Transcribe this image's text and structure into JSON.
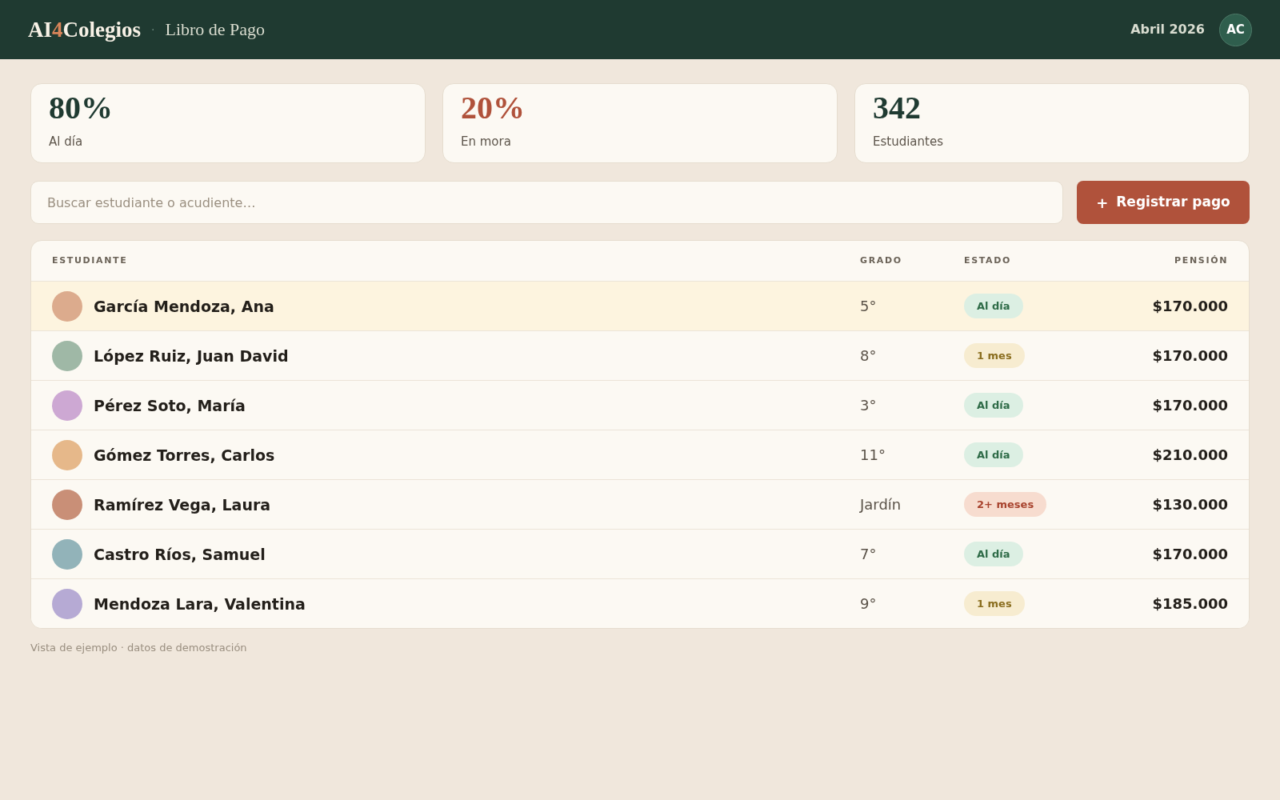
{
  "header": {
    "logo": {
      "before": "AI",
      "accent": "4",
      "after": "Colegios"
    },
    "separator": "·",
    "section": "Libro de Pago",
    "period": "Abril 2026",
    "avatar": "AC"
  },
  "stats": [
    {
      "value": "80%",
      "label": "Al día",
      "kind": "ok"
    },
    {
      "value": "20%",
      "label": "En mora",
      "kind": "alert"
    },
    {
      "value": "342",
      "label": "Estudiantes",
      "kind": "count"
    }
  ],
  "search": {
    "placeholder": "Buscar estudiante o acudiente…"
  },
  "register_button": {
    "icon": "+",
    "label": "Registrar pago"
  },
  "table": {
    "columns": [
      {
        "label": "ESTUDIANTE"
      },
      {
        "label": "GRADO"
      },
      {
        "label": "ESTADO"
      },
      {
        "label": "PENSIÓN"
      }
    ],
    "rows": [
      {
        "selected": true,
        "color": "#dcab8d",
        "name": "García Mendoza, Ana",
        "grade": "5°",
        "status": {
          "label": "Al día",
          "kind": "paid"
        },
        "amount": "$170.000"
      },
      {
        "selected": false,
        "color": "#9fb8a6",
        "name": "López Ruiz, Juan David",
        "grade": "8°",
        "status": {
          "label": "1 mes",
          "kind": "late"
        },
        "amount": "$170.000"
      },
      {
        "selected": false,
        "color": "#cda8d3",
        "name": "Pérez Soto, María",
        "grade": "3°",
        "status": {
          "label": "Al día",
          "kind": "paid"
        },
        "amount": "$170.000"
      },
      {
        "selected": false,
        "color": "#e6b88a",
        "name": "Gómez Torres, Carlos",
        "grade": "11°",
        "status": {
          "label": "Al día",
          "kind": "paid"
        },
        "amount": "$210.000"
      },
      {
        "selected": false,
        "color": "#c98f77",
        "name": "Ramírez Vega, Laura",
        "grade": "Jardín",
        "status": {
          "label": "2+ meses",
          "kind": "overdue"
        },
        "amount": "$130.000"
      },
      {
        "selected": false,
        "color": "#92b3b9",
        "name": "Castro Ríos, Samuel",
        "grade": "7°",
        "status": {
          "label": "Al día",
          "kind": "paid"
        },
        "amount": "$170.000"
      },
      {
        "selected": false,
        "color": "#b6aad4",
        "name": "Mendoza Lara, Valentina",
        "grade": "9°",
        "status": {
          "label": "1 mes",
          "kind": "late"
        },
        "amount": "$185.000"
      }
    ]
  },
  "footer": "Vista de ejemplo · datos de demostración"
}
